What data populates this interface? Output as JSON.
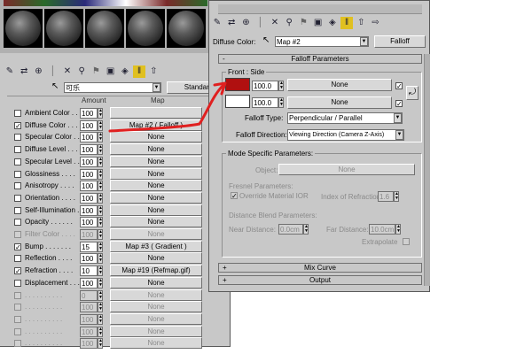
{
  "left_panel": {
    "toolbar_icons": [
      "eyedropper-icon",
      "assign-material-icon",
      "put-to-scene-icon",
      "reset-icon",
      "delete-icon",
      "unique-icon",
      "put-to-library-icon",
      "effects-channel-icon",
      "show-map-icon",
      "show-end-icon",
      "go-to-parent-icon"
    ],
    "material_name": "可乐",
    "type_button": "Standard",
    "col_amount": "Amount",
    "col_map": "Map",
    "rows": [
      {
        "label": "Ambient Color . .",
        "checked": false,
        "amount": "100",
        "map": "",
        "enabled": true
      },
      {
        "label": "Diffuse Color . . .",
        "checked": true,
        "amount": "100",
        "map": "Map #2  ( Falloff )",
        "enabled": true
      },
      {
        "label": "Specular Color . .",
        "checked": false,
        "amount": "100",
        "map": "None",
        "enabled": true
      },
      {
        "label": "Diffuse Level . . .",
        "checked": false,
        "amount": "100",
        "map": "None",
        "enabled": true
      },
      {
        "label": "Specular Level . .",
        "checked": false,
        "amount": "100",
        "map": "None",
        "enabled": true
      },
      {
        "label": "Glossiness . . . .",
        "checked": false,
        "amount": "100",
        "map": "None",
        "enabled": true
      },
      {
        "label": "Anisotropy . . . .",
        "checked": false,
        "amount": "100",
        "map": "None",
        "enabled": true
      },
      {
        "label": "Orientation . . . .",
        "checked": false,
        "amount": "100",
        "map": "None",
        "enabled": true
      },
      {
        "label": "Self-Illumination .",
        "checked": false,
        "amount": "100",
        "map": "None",
        "enabled": true
      },
      {
        "label": "Opacity . . . . . .",
        "checked": false,
        "amount": "100",
        "map": "None",
        "enabled": true
      },
      {
        "label": "Filter Color . . . .",
        "checked": false,
        "amount": "100",
        "map": "None",
        "enabled": false
      },
      {
        "label": "Bump . . . . . . .",
        "checked": true,
        "amount": "15",
        "map": "Map #3  ( Gradient )",
        "enabled": true
      },
      {
        "label": "Reflection . . . .",
        "checked": false,
        "amount": "100",
        "map": "None",
        "enabled": true
      },
      {
        "label": "Refraction . . . .",
        "checked": true,
        "amount": "10",
        "map": "Map #19 (Refmap.gif)",
        "enabled": true
      },
      {
        "label": "Displacement . . .",
        "checked": false,
        "amount": "100",
        "map": "None",
        "enabled": true
      },
      {
        "label": ". . . . . . . . . .",
        "checked": false,
        "amount": "0",
        "map": "None",
        "enabled": false
      },
      {
        "label": ". . . . . . . . . .",
        "checked": false,
        "amount": "100",
        "map": "None",
        "enabled": false
      },
      {
        "label": ". . . . . . . . . .",
        "checked": false,
        "amount": "100",
        "map": "None",
        "enabled": false
      },
      {
        "label": ". . . . . . . . . .",
        "checked": false,
        "amount": "100",
        "map": "None",
        "enabled": false
      },
      {
        "label": ". . . . . . . . . .",
        "checked": false,
        "amount": "100",
        "map": "None",
        "enabled": false
      }
    ]
  },
  "right_panel": {
    "toolbar_icons": [
      "eyedropper-icon",
      "assign-material-icon",
      "put-to-scene-icon",
      "reset-icon",
      "delete-icon",
      "unique-icon",
      "put-to-library-icon",
      "effects-channel-icon",
      "show-map-icon",
      "show-end-icon",
      "go-to-parent-icon",
      "go-forward-icon"
    ],
    "slot_label": "Diffuse Color:",
    "map_name": "Map #2",
    "type_button": "Falloff",
    "falloff_rollout": "Falloff Parameters",
    "front_side_label": "Front : Side",
    "front": {
      "color": "#b01010",
      "amount": "100.0",
      "map": "None",
      "checked": true
    },
    "side": {
      "color": "#ffffff",
      "amount": "100.0",
      "map": "None",
      "checked": true
    },
    "falloff_type_label": "Falloff Type:",
    "falloff_type_value": "Perpendicular / Parallel",
    "falloff_direction_label": "Falloff Direction:",
    "falloff_direction_value": "Viewing Direction (Camera Z-Axis)",
    "mode_group_label": "Mode Specific Parameters:",
    "object_label": "Object:",
    "object_value": "None",
    "fresnel_label": "Fresnel Parameters:",
    "override_ior_label": "Override Material IOR",
    "ior_label": "Index of Refraction",
    "ior_value": "1.6",
    "distance_blend_label": "Distance Blend Parameters:",
    "near_label": "Near Distance:",
    "near_value": "0.0cm",
    "far_label": "Far Distance:",
    "far_value": "10.0cm",
    "extrapolate_label": "Extrapolate",
    "mix_curve_rollout": "Mix Curve",
    "output_rollout": "Output",
    "rollout_minus": "-",
    "rollout_plus": "+"
  },
  "annotation": {
    "color": "#e02020"
  }
}
